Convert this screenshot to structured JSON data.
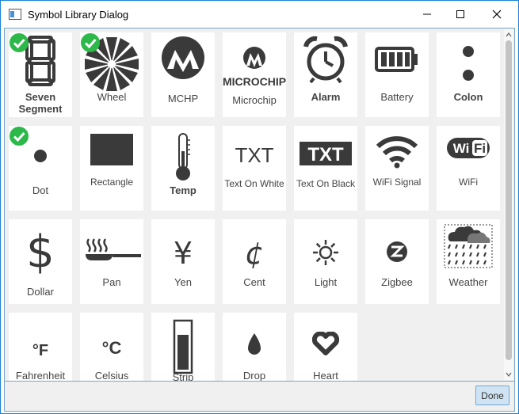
{
  "window": {
    "title": "Symbol Library Dialog",
    "minimize_icon": "minimize-icon",
    "maximize_icon": "maximize-icon",
    "close_icon": "close-icon"
  },
  "colors": {
    "accent": "#1883d7",
    "check": "#2db84a",
    "symbol": "#3a3a3a",
    "tile_bg": "#ffffff",
    "panel_bg": "#f0f0f0"
  },
  "symbols": [
    {
      "label": "Seven Segment",
      "label2": "Segment",
      "label1": "Seven",
      "icon": "seven-segment-icon",
      "selected": true
    },
    {
      "label": "Wheel",
      "icon": "wheel-icon",
      "selected": true
    },
    {
      "label": "MCHP",
      "icon": "mchp-logo-icon",
      "selected": false
    },
    {
      "label": "Microchip",
      "icon": "microchip-logo-icon",
      "selected": false,
      "logo_text": "MICROCHIP"
    },
    {
      "label": "Alarm",
      "icon": "alarm-clock-icon",
      "selected": false
    },
    {
      "label": "Battery",
      "icon": "battery-icon",
      "selected": false
    },
    {
      "label": "Colon",
      "icon": "colon-icon",
      "selected": false
    },
    {
      "label": "Dot",
      "icon": "dot-icon",
      "selected": true
    },
    {
      "label": "Rectangle",
      "icon": "rectangle-icon",
      "selected": false
    },
    {
      "label": "Temp",
      "icon": "thermometer-icon",
      "selected": false
    },
    {
      "label": "Text On White",
      "icon": "text-on-white-icon",
      "selected": false,
      "glyph_text": "TXT"
    },
    {
      "label": "Text On Black",
      "icon": "text-on-black-icon",
      "selected": false,
      "glyph_text": "TXT"
    },
    {
      "label": "WiFi Signal",
      "icon": "wifi-signal-icon",
      "selected": false
    },
    {
      "label": "WiFi",
      "icon": "wifi-logo-icon",
      "selected": false,
      "glyph_text": "WiFi"
    },
    {
      "label": "Dollar",
      "icon": "dollar-icon",
      "selected": false,
      "glyph_text": "$"
    },
    {
      "label": "Pan",
      "icon": "pan-icon",
      "selected": false
    },
    {
      "label": "Yen",
      "icon": "yen-icon",
      "selected": false,
      "glyph_text": "¥"
    },
    {
      "label": "Cent",
      "icon": "cent-icon",
      "selected": false,
      "glyph_text": "¢"
    },
    {
      "label": "Light",
      "icon": "light-sun-icon",
      "selected": false
    },
    {
      "label": "Zigbee",
      "icon": "zigbee-icon",
      "selected": false
    },
    {
      "label": "Weather",
      "icon": "weather-cloud-rain-icon",
      "selected": false
    },
    {
      "label": "Fahrenheit",
      "icon": "fahrenheit-icon",
      "selected": false,
      "glyph_text": "°F"
    },
    {
      "label": "Celsius",
      "icon": "celsius-icon",
      "selected": false,
      "glyph_text": "°C"
    },
    {
      "label": "Strip",
      "icon": "strip-icon",
      "selected": false
    },
    {
      "label": "Drop",
      "icon": "drop-icon",
      "selected": false
    },
    {
      "label": "Heart",
      "icon": "heart-icon",
      "selected": false
    }
  ],
  "footer": {
    "done_label": "Done"
  }
}
